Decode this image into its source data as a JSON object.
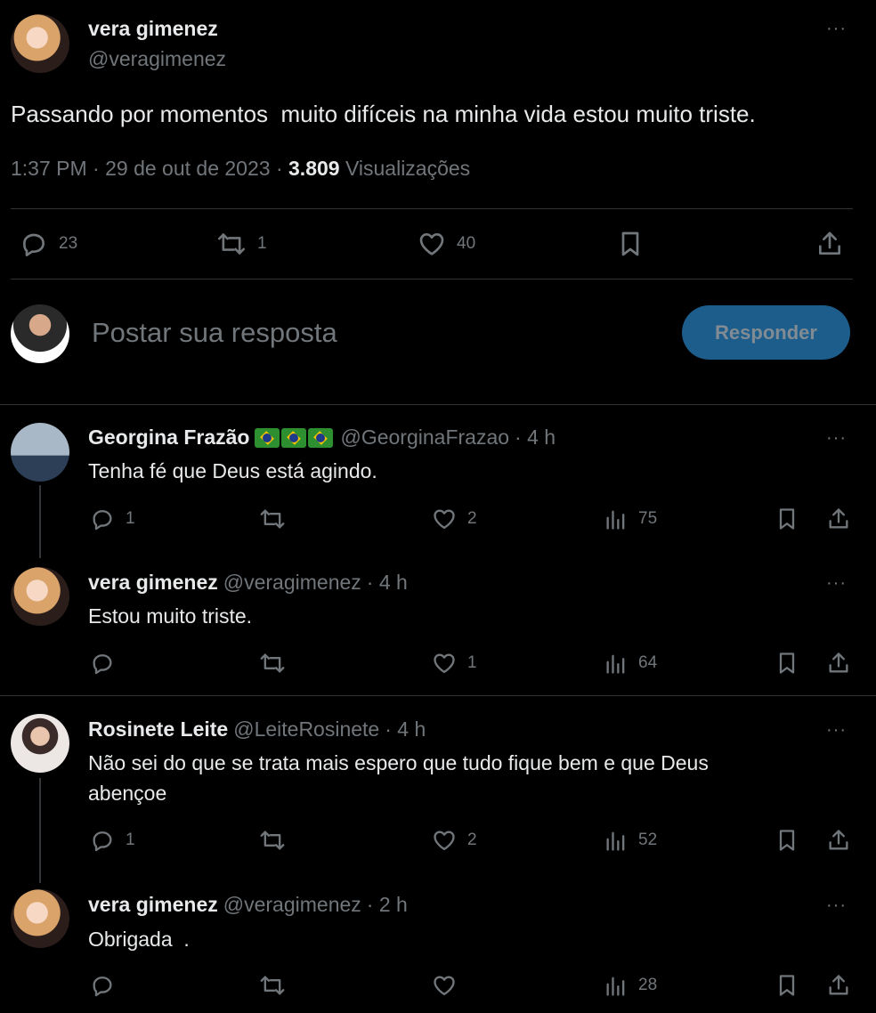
{
  "main_tweet": {
    "author_name": "vera gimenez",
    "author_handle": "@veragimenez",
    "text": "Passando por momentos  muito difíceis na minha vida estou muito triste.",
    "time": "1:37 PM",
    "separator": "·",
    "date": "29 de out de 2023",
    "views_count": "3.809",
    "views_label": "Visualizações",
    "reply_count": "23",
    "retweet_count": "1",
    "like_count": "40"
  },
  "compose": {
    "placeholder": "Postar sua resposta",
    "button_label": "Responder"
  },
  "replies": [
    {
      "name": "Georgina Frazão",
      "flags": "🇧🇷🇧🇷🇧🇷",
      "handle": "@GeorginaFrazao",
      "time": "· 4 h",
      "text": "Tenha fé que Deus está agindo.",
      "replies": "1",
      "likes": "2",
      "views": "75"
    },
    {
      "name": "vera gimenez",
      "handle": "@veragimenez",
      "time": "· 4 h",
      "text": "Estou muito triste.",
      "replies": "",
      "likes": "1",
      "views": "64"
    },
    {
      "name": "Rosinete Leite",
      "handle": "@LeiteRosinete",
      "time": "· 4 h",
      "text": "Não sei do que se trata mais espero que tudo fique bem e que Deus abençoe",
      "replies": "1",
      "likes": "2",
      "views": "52"
    },
    {
      "name": "vera gimenez",
      "handle": "@veragimenez",
      "time": "· 2 h",
      "text": "Obrigada  .",
      "replies": "",
      "likes": "",
      "views": "28"
    }
  ],
  "more_label": "···",
  "colors": {
    "background": "#000000",
    "text": "#e7e9ea",
    "muted": "#71767b",
    "divider": "#2f3336",
    "reply_button": "#1d5d8c"
  }
}
